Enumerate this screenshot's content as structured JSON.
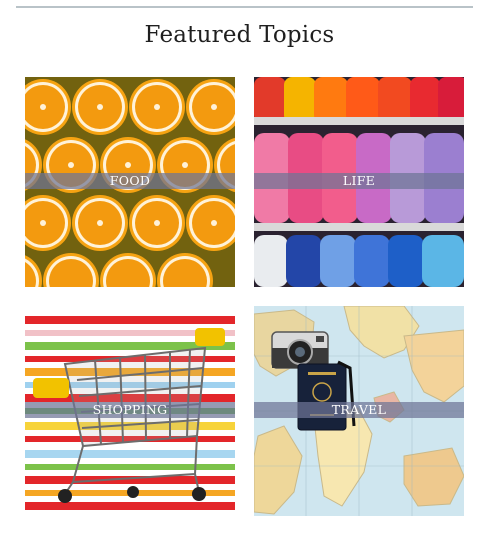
{
  "heading": "Featured Topics",
  "topics": [
    {
      "label": "FOOD",
      "image": "orange-slices"
    },
    {
      "label": "LIFE",
      "image": "yarn-shelves"
    },
    {
      "label": "SHOPPING",
      "image": "shopping-cart-stripes"
    },
    {
      "label": "TRAVEL",
      "image": "world-map-camera-passport"
    }
  ],
  "colors": {
    "heading_text": "#1f1f1f",
    "divider": "#b9c3c8",
    "label_band": "#6e7496",
    "label_text": "#ffffff"
  }
}
